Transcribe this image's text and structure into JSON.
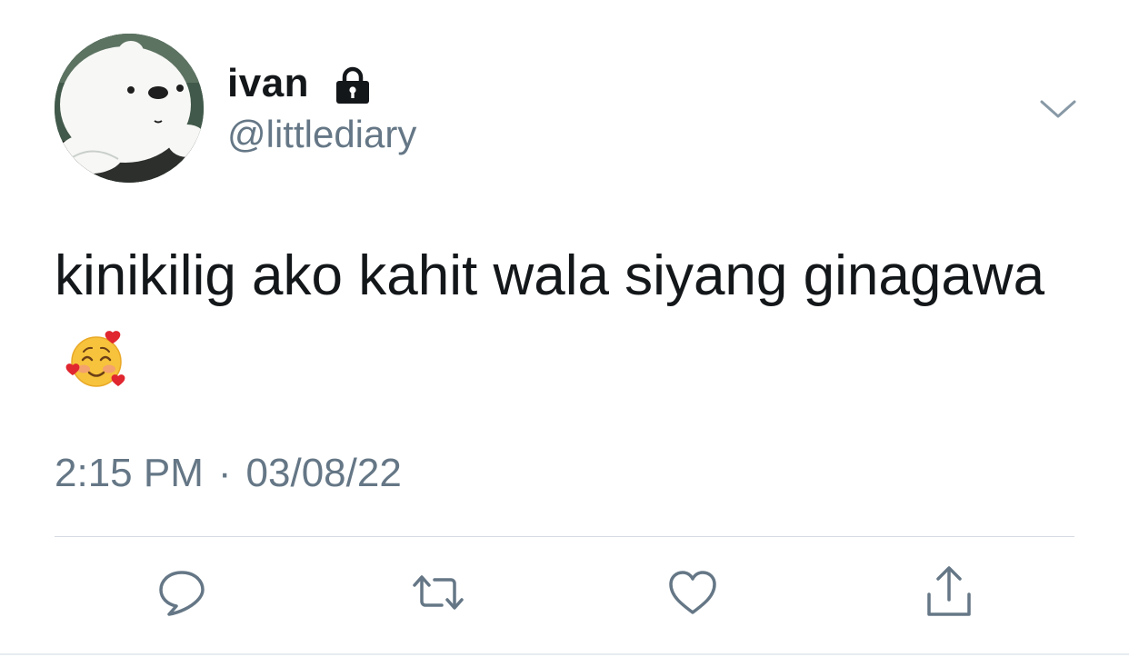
{
  "author": {
    "display_name": "ivan",
    "handle": "@littlediary",
    "protected": true
  },
  "tweet": {
    "text": "kinikilig ako kahit wala siyang ginagawa",
    "emoji": "smiling-face-with-hearts"
  },
  "meta": {
    "time": "2:15 PM",
    "separator": "·",
    "date": "03/08/22"
  },
  "actions": [
    "reply",
    "retweet",
    "like",
    "share"
  ],
  "colors": {
    "text": "#14171a",
    "secondary": "#657786",
    "divider": "#d5dbe0",
    "background": "#ffffff"
  }
}
